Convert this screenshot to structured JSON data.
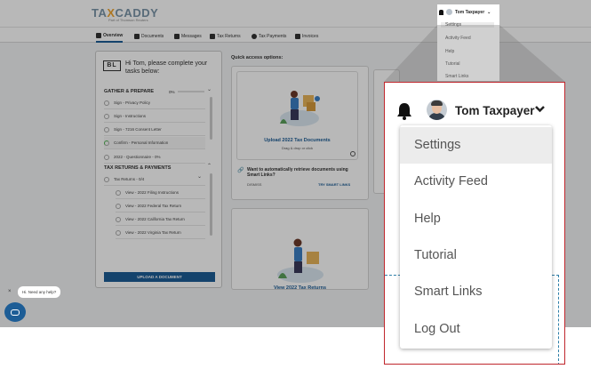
{
  "header": {
    "logo_main_a": "TA",
    "logo_main_x": "X",
    "logo_main_b": "CADDY",
    "logo_sub": "Part of Thomson Reuters"
  },
  "nav": {
    "tabs": [
      {
        "label": "Overview",
        "icon": "home-icon",
        "active": true
      },
      {
        "label": "Documents",
        "icon": "documents-icon"
      },
      {
        "label": "Messages",
        "icon": "messages-icon"
      },
      {
        "label": "Tax Returns",
        "icon": "tax-returns-icon"
      },
      {
        "label": "Tax Payments",
        "icon": "tax-payments-icon"
      },
      {
        "label": "Invoices",
        "icon": "invoices-icon"
      }
    ]
  },
  "tasks": {
    "logo_initials": "BL",
    "greeting": "Hi Tom, please complete your tasks below:",
    "gather_title": "GATHER & PREPARE",
    "gather_percent": "0%",
    "gather_items": [
      "Sign - Privacy Policy",
      "Sign - Instructions",
      "Sign - 7216 Consent Letter",
      "Confirm - Personal Information",
      "2022 - Questionnaire - 0%"
    ],
    "returns_title": "TAX RETURNS & PAYMENTS",
    "returns_group": "Tax Returns - 0/4",
    "returns_items": [
      "View - 2022 Filing Instructions",
      "View - 2022 Federal Tax Return",
      "View - 2022 California Tax Return",
      "View - 2022 Virginia Tax Return"
    ],
    "upload_button": "UPLOAD A DOCUMENT"
  },
  "quick_access": {
    "title": "Quick access options:",
    "card1_title": "Upload 2022 Tax Documents",
    "card1_sub": "Drag & drop or click",
    "card1_note": "Want to automatically retrieve documents using Smart Links?",
    "card1_dismiss": "DISMISS",
    "card1_try": "TRY SMART LINKS",
    "card2_title": "View 2022 Tax Returns"
  },
  "chat": {
    "bubble": "Hi. Need any help?",
    "close": "×"
  },
  "user_menu": {
    "name": "Tom Taxpayer",
    "items": [
      "Settings",
      "Activity Feed",
      "Help",
      "Tutorial",
      "Smart Links",
      "Log Out"
    ],
    "selected_index": 0
  },
  "colors": {
    "brand_blue": "#1d5d96",
    "highlight_border": "#c0272d",
    "logo_accent": "#f0a630"
  }
}
